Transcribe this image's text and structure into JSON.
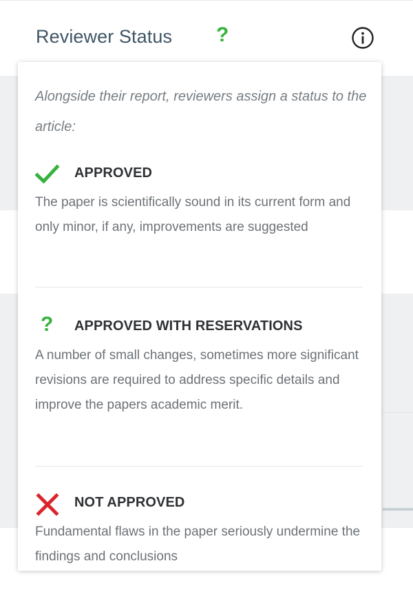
{
  "header": {
    "title": "Reviewer Status",
    "status_mark": "?",
    "info_icon": "info-icon"
  },
  "popup": {
    "intro": "Alongside their report, reviewers assign a status to the article:",
    "statuses": [
      {
        "icon": "checkmark-icon",
        "label": "APPROVED",
        "description": "The paper is scientifically sound in its current form and only minor, if any, improvements are suggested",
        "color": "#35b23e"
      },
      {
        "icon": "question-icon",
        "mark": "?",
        "label": "APPROVED WITH RESERVATIONS",
        "description": "A number of small changes, sometimes more significant revisions are required to address specific details and improve the papers academic merit.",
        "color": "#35b23e"
      },
      {
        "icon": "cross-icon",
        "label": "NOT APPROVED",
        "description": "Fundamental flaws in the paper seriously undermine the findings and conclusions",
        "color": "#d9262d"
      }
    ]
  },
  "colors": {
    "title": "#3f5566",
    "approved": "#35b23e",
    "not_approved": "#d9262d",
    "text_muted": "#6c7277"
  }
}
